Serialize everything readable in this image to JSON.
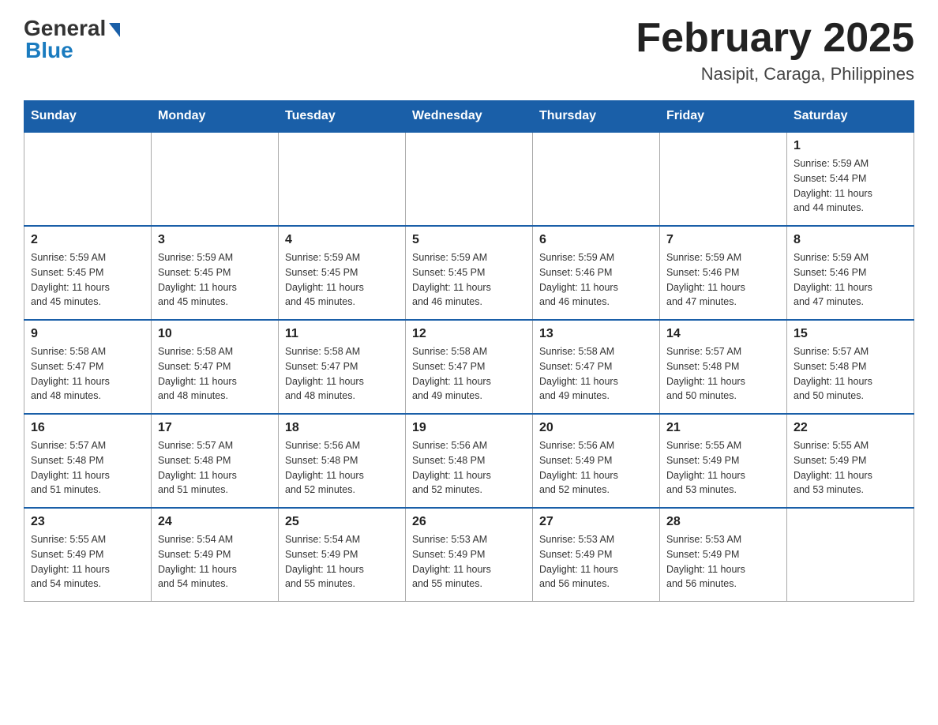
{
  "header": {
    "logo_general": "General",
    "logo_blue": "Blue",
    "month_title": "February 2025",
    "location": "Nasipit, Caraga, Philippines"
  },
  "days_of_week": [
    "Sunday",
    "Monday",
    "Tuesday",
    "Wednesday",
    "Thursday",
    "Friday",
    "Saturday"
  ],
  "weeks": [
    [
      {
        "day": "",
        "info": ""
      },
      {
        "day": "",
        "info": ""
      },
      {
        "day": "",
        "info": ""
      },
      {
        "day": "",
        "info": ""
      },
      {
        "day": "",
        "info": ""
      },
      {
        "day": "",
        "info": ""
      },
      {
        "day": "1",
        "info": "Sunrise: 5:59 AM\nSunset: 5:44 PM\nDaylight: 11 hours\nand 44 minutes."
      }
    ],
    [
      {
        "day": "2",
        "info": "Sunrise: 5:59 AM\nSunset: 5:45 PM\nDaylight: 11 hours\nand 45 minutes."
      },
      {
        "day": "3",
        "info": "Sunrise: 5:59 AM\nSunset: 5:45 PM\nDaylight: 11 hours\nand 45 minutes."
      },
      {
        "day": "4",
        "info": "Sunrise: 5:59 AM\nSunset: 5:45 PM\nDaylight: 11 hours\nand 45 minutes."
      },
      {
        "day": "5",
        "info": "Sunrise: 5:59 AM\nSunset: 5:45 PM\nDaylight: 11 hours\nand 46 minutes."
      },
      {
        "day": "6",
        "info": "Sunrise: 5:59 AM\nSunset: 5:46 PM\nDaylight: 11 hours\nand 46 minutes."
      },
      {
        "day": "7",
        "info": "Sunrise: 5:59 AM\nSunset: 5:46 PM\nDaylight: 11 hours\nand 47 minutes."
      },
      {
        "day": "8",
        "info": "Sunrise: 5:59 AM\nSunset: 5:46 PM\nDaylight: 11 hours\nand 47 minutes."
      }
    ],
    [
      {
        "day": "9",
        "info": "Sunrise: 5:58 AM\nSunset: 5:47 PM\nDaylight: 11 hours\nand 48 minutes."
      },
      {
        "day": "10",
        "info": "Sunrise: 5:58 AM\nSunset: 5:47 PM\nDaylight: 11 hours\nand 48 minutes."
      },
      {
        "day": "11",
        "info": "Sunrise: 5:58 AM\nSunset: 5:47 PM\nDaylight: 11 hours\nand 48 minutes."
      },
      {
        "day": "12",
        "info": "Sunrise: 5:58 AM\nSunset: 5:47 PM\nDaylight: 11 hours\nand 49 minutes."
      },
      {
        "day": "13",
        "info": "Sunrise: 5:58 AM\nSunset: 5:47 PM\nDaylight: 11 hours\nand 49 minutes."
      },
      {
        "day": "14",
        "info": "Sunrise: 5:57 AM\nSunset: 5:48 PM\nDaylight: 11 hours\nand 50 minutes."
      },
      {
        "day": "15",
        "info": "Sunrise: 5:57 AM\nSunset: 5:48 PM\nDaylight: 11 hours\nand 50 minutes."
      }
    ],
    [
      {
        "day": "16",
        "info": "Sunrise: 5:57 AM\nSunset: 5:48 PM\nDaylight: 11 hours\nand 51 minutes."
      },
      {
        "day": "17",
        "info": "Sunrise: 5:57 AM\nSunset: 5:48 PM\nDaylight: 11 hours\nand 51 minutes."
      },
      {
        "day": "18",
        "info": "Sunrise: 5:56 AM\nSunset: 5:48 PM\nDaylight: 11 hours\nand 52 minutes."
      },
      {
        "day": "19",
        "info": "Sunrise: 5:56 AM\nSunset: 5:48 PM\nDaylight: 11 hours\nand 52 minutes."
      },
      {
        "day": "20",
        "info": "Sunrise: 5:56 AM\nSunset: 5:49 PM\nDaylight: 11 hours\nand 52 minutes."
      },
      {
        "day": "21",
        "info": "Sunrise: 5:55 AM\nSunset: 5:49 PM\nDaylight: 11 hours\nand 53 minutes."
      },
      {
        "day": "22",
        "info": "Sunrise: 5:55 AM\nSunset: 5:49 PM\nDaylight: 11 hours\nand 53 minutes."
      }
    ],
    [
      {
        "day": "23",
        "info": "Sunrise: 5:55 AM\nSunset: 5:49 PM\nDaylight: 11 hours\nand 54 minutes."
      },
      {
        "day": "24",
        "info": "Sunrise: 5:54 AM\nSunset: 5:49 PM\nDaylight: 11 hours\nand 54 minutes."
      },
      {
        "day": "25",
        "info": "Sunrise: 5:54 AM\nSunset: 5:49 PM\nDaylight: 11 hours\nand 55 minutes."
      },
      {
        "day": "26",
        "info": "Sunrise: 5:53 AM\nSunset: 5:49 PM\nDaylight: 11 hours\nand 55 minutes."
      },
      {
        "day": "27",
        "info": "Sunrise: 5:53 AM\nSunset: 5:49 PM\nDaylight: 11 hours\nand 56 minutes."
      },
      {
        "day": "28",
        "info": "Sunrise: 5:53 AM\nSunset: 5:49 PM\nDaylight: 11 hours\nand 56 minutes."
      },
      {
        "day": "",
        "info": ""
      }
    ]
  ]
}
